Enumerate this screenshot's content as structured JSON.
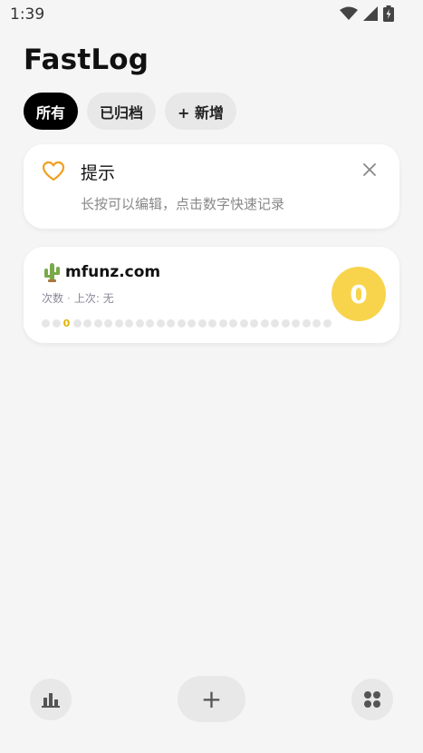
{
  "status_bar": {
    "time": "1:39",
    "icons": [
      "wifi-icon",
      "signal-icon",
      "battery-icon"
    ]
  },
  "app": {
    "title": "FastLog"
  },
  "tabs": [
    {
      "label": "所有",
      "active": true
    },
    {
      "label": "已归档",
      "active": false
    },
    {
      "label": "+ 新增",
      "active": false
    }
  ],
  "tip": {
    "icon": "heart-icon",
    "title": "提示",
    "description": "长按可以编辑，点击数字快速记录",
    "close_icon": "close-icon"
  },
  "counter": {
    "emoji": "🌵",
    "name": "mfunz.com",
    "meta_count_label": "次数",
    "meta_separator": "·",
    "meta_last_label": "上次: 无",
    "highlight_number": "0",
    "count": "0"
  },
  "bottom_bar": {
    "left_icon": "bar-chart-icon",
    "center_label": "+",
    "right_icon": "grid-dots-icon"
  },
  "colors": {
    "accent_yellow": "#f8d44d",
    "heart_orange": "#f0a020",
    "tab_active_bg": "#000000",
    "tab_inactive_bg": "#e8e8e8",
    "background": "#f5f5f5"
  }
}
